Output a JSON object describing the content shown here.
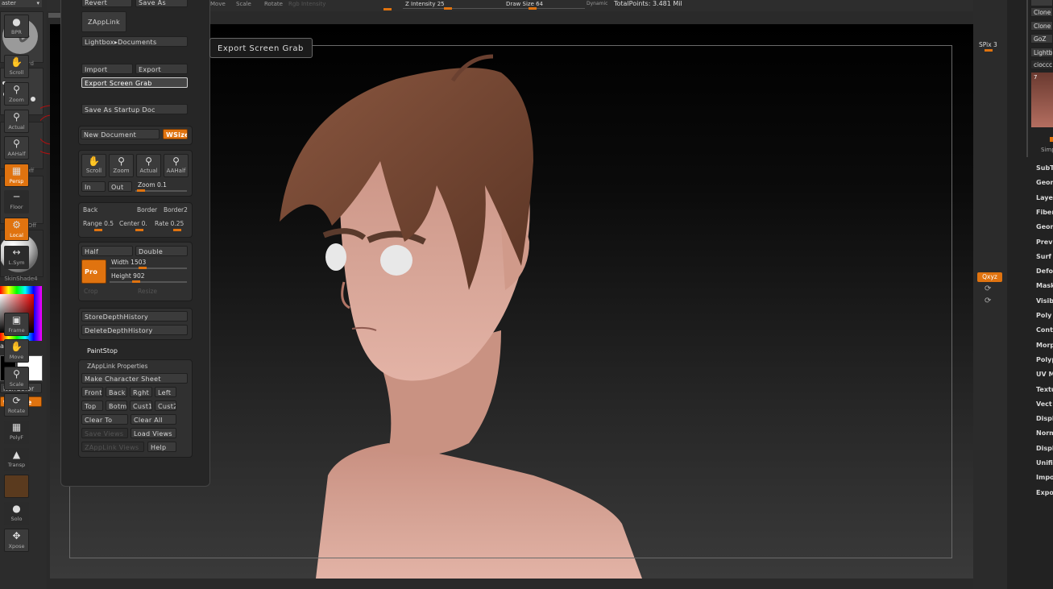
{
  "top_bar": {
    "partial_left_label": "aster",
    "move": "Move",
    "scale": "Scale",
    "rotate": "Rotate",
    "rgb_intensity": "Rgb Intensity",
    "z_intensity": "Z Intensity 25",
    "draw_size": "Draw Size 64",
    "dynamic": "Dynamic",
    "total_points": "TotalPoints: 3.481 Mil"
  },
  "left_shelf": {
    "brush_label": "Standard",
    "stroke_label": "Dots",
    "alpha_label": "Alpha Off",
    "texture_label": "Texture Off",
    "material_label": "SkinShade4",
    "gradient_label": "adient",
    "switch_color": "itchColor",
    "alternate": "ternate"
  },
  "document_menu": {
    "partial_top_left": "Revert",
    "partial_top_right": "Save As",
    "zapplink": "ZAppLink",
    "lightbox_documents": "Lightbox▸Documents",
    "import": "Import",
    "export": "Export",
    "export_screen_grab": "Export Screen Grab",
    "save_as_startup_doc": "Save As Startup Doc",
    "new_document": "New Document",
    "wsize": "WSize",
    "scroll": "Scroll",
    "zoom": "Zoom",
    "actual": "Actual",
    "aahalf": "AAHalf",
    "in": "In",
    "out": "Out",
    "zoom_value": "Zoom 0.1",
    "back": "Back",
    "border": "Border",
    "border2": "Border2",
    "range": "Range 0.5",
    "center": "Center 0.",
    "rate": "Rate 0.25",
    "half": "Half",
    "double": "Double",
    "pro": "Pro",
    "width": "Width 1503",
    "height": "Height 902",
    "crop": "Crop",
    "resize": "Resize",
    "store_depth_history": "StoreDepthHistory",
    "delete_depth_history": "DeleteDepthHistory",
    "paint_stop": "PaintStop",
    "zapplink_properties": "ZAppLink Properties",
    "make_character_sheet": "Make Character Sheet",
    "front": "Front",
    "back_view": "Back",
    "right": "Rght",
    "left": "Left",
    "top": "Top",
    "bottom": "Botm",
    "cust1": "Cust1",
    "cust2": "Cust2",
    "clear_to": "Clear To",
    "clear_all": "Clear All",
    "save_views": "Save Views",
    "load_views": "Load Views",
    "zapplink_views": "ZAppLink Views",
    "help": "Help"
  },
  "tooltip": {
    "text": "Export Screen Grab"
  },
  "right_shelf": {
    "bpr": "BPR",
    "spix": "SPix 3",
    "scroll": "Scroll",
    "zoom": "Zoom",
    "actual": "Actual",
    "aahalf": "AAHalf",
    "persp": "Persp",
    "floor": "Floor",
    "local": "Local",
    "lsym": "L.Sym",
    "xyz": "Qxyz",
    "frame": "Frame",
    "move": "Move",
    "scale": "Scale",
    "rotate": "Rotate",
    "polyf": "PolyF",
    "transp": "Transp",
    "solo": "Solo",
    "xpose": "Xpose"
  },
  "right_palette": {
    "buttons": [
      "Clone",
      "Clone",
      "GoZ",
      "Lightb",
      "cioccc"
    ],
    "thumb_count": "7",
    "simp": "Simp",
    "items": [
      "SubT",
      "Geom",
      "Laye",
      "Fiber",
      "Geom",
      "Prev",
      "Surf",
      "Defo",
      "Mask",
      "Visib",
      "Poly",
      "Cont",
      "Morp",
      "Polyp",
      "UV M",
      "Textu",
      "Vect",
      "Displ",
      "Norm",
      "Displ",
      "Unifi",
      "Impo",
      "Expo"
    ]
  },
  "colors": {
    "accent": "#e0730f",
    "panel": "#303030",
    "background": "#2a2a2a"
  }
}
